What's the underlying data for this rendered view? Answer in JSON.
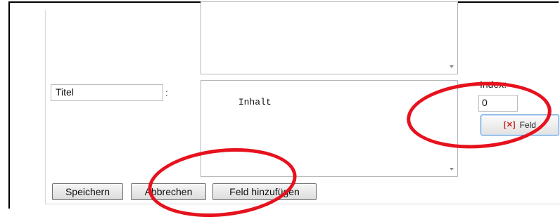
{
  "form": {
    "field_title": {
      "value": "Titel"
    },
    "separator": ":",
    "field_content": {
      "value": "Inhalt"
    },
    "index": {
      "label": "Index:",
      "value": "0"
    },
    "field_remove_button": {
      "icon": "remove-x-icon",
      "label": "Feld"
    }
  },
  "actions": {
    "save_label": "Speichern",
    "cancel_label": "Abbrechen",
    "add_field_label": "Feld hinzufügen"
  },
  "colors": {
    "annotation_red": "#e6121d",
    "button_focus_border": "#4a90d9"
  }
}
